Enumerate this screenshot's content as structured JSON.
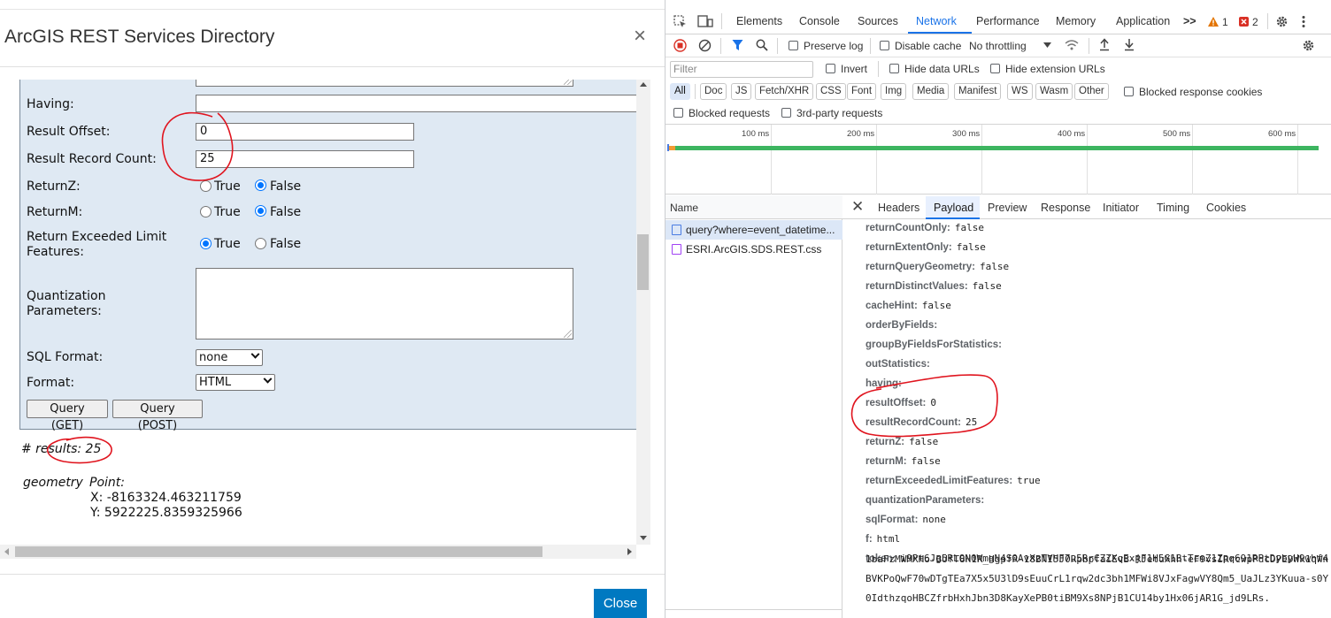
{
  "dialog": {
    "title": "ArcGIS REST Services Directory",
    "close_x": "×",
    "close_button": "Close",
    "form": {
      "having_label": "Having:",
      "result_offset_label": "Result Offset:",
      "result_offset_value": "0",
      "result_record_count_label": "Result Record Count:",
      "result_record_count_value": "25",
      "returnz_label": "ReturnZ:",
      "returnm_label": "ReturnM:",
      "exceeded_label_1": "Return Exceeded Limit",
      "exceeded_label_2": "Features:",
      "quant_label_1": "Quantization",
      "quant_label_2": "Parameters:",
      "sql_format_label": "SQL Format:",
      "sql_format_value": "none",
      "format_label": "Format:",
      "format_value": "HTML",
      "true_label": "True",
      "false_label": "False",
      "query_get": "Query (GET)",
      "query_post": "Query (POST)"
    },
    "results": {
      "count_text": "# results: 25",
      "geometry_label": "geometry",
      "geometry_type": "Point:",
      "x_text": "X: -8163324.463211759",
      "y_text": "Y: 5922225.8359325966"
    }
  },
  "devtools": {
    "tabs": [
      "Elements",
      "Console",
      "Sources",
      "Network",
      "Performance",
      "Memory",
      "Application"
    ],
    "active_tab": "Network",
    "more_tabs": ">>",
    "warnings_count": "1",
    "errors_count": "2",
    "toolbar": {
      "preserve_log": "Preserve log",
      "disable_cache": "Disable cache",
      "throttling": "No throttling"
    },
    "filter": {
      "placeholder": "Filter",
      "invert": "Invert",
      "hide_data_urls": "Hide data URLs",
      "hide_extension_urls": "Hide extension URLs"
    },
    "types": [
      "All",
      "Doc",
      "JS",
      "Fetch/XHR",
      "CSS",
      "Font",
      "Img",
      "Media",
      "Manifest",
      "WS",
      "Wasm",
      "Other"
    ],
    "blocked_response_cookies": "Blocked response cookies",
    "blocked_requests": "Blocked requests",
    "third_party_requests": "3rd-party requests",
    "timeline_ticks": [
      "100 ms",
      "200 ms",
      "300 ms",
      "400 ms",
      "500 ms",
      "600 ms"
    ],
    "request_list": {
      "header": "Name",
      "rows": [
        "query?where=event_datetime...",
        "ESRI.ArcGIS.SDS.REST.css"
      ]
    },
    "detail_tabs": [
      "Headers",
      "Payload",
      "Preview",
      "Response",
      "Initiator",
      "Timing",
      "Cookies"
    ],
    "active_detail_tab": "Payload",
    "payload": [
      {
        "k": "returnCountOnly:",
        "v": "false"
      },
      {
        "k": "returnExtentOnly:",
        "v": "false"
      },
      {
        "k": "returnQueryGeometry:",
        "v": "false"
      },
      {
        "k": "returnDistinctValues:",
        "v": "false"
      },
      {
        "k": "cacheHint:",
        "v": "false"
      },
      {
        "k": "orderByFields:",
        "v": ""
      },
      {
        "k": "groupByFieldsForStatistics:",
        "v": ""
      },
      {
        "k": "outStatistics:",
        "v": ""
      },
      {
        "k": "having:",
        "v": ""
      },
      {
        "k": "resultOffset:",
        "v": "0"
      },
      {
        "k": "resultRecordCount:",
        "v": "25"
      },
      {
        "k": "returnZ:",
        "v": "false"
      },
      {
        "k": "returnM:",
        "v": "false"
      },
      {
        "k": "returnExceededLimitFeatures:",
        "v": "true"
      },
      {
        "k": "quantizationParameters:",
        "v": ""
      },
      {
        "k": "sqlFormat:",
        "v": "none"
      },
      {
        "k": "f:",
        "v": "html"
      },
      {
        "k": "token:",
        "v": "i9Pt6Jg5RLON0WmgN4S0AvXzTVHF7u5RrCZZXqExjF1H5G1BtTcmZ1Zpq691RPtDybyH9whf4"
      }
    ],
    "token_continuation": [
      "1baFzMWMXHo-BUfT8H1R_HgpfR-18BNI5J0RpbpfaiEvB-RJetuXhh-eF9vsIRrcwpPdcDPEDWk1qWn",
      "BVKPoQwF70wDTgTEa7X5x5U3lD9sEuuCrL1rqw2dc3bh1MFWi8VJxFagwVY8Qm5_UaJLz3YKuua-s0Y",
      "0IdthzqoHBCZfrbHxhJbn3D8KayXePB0tiBM9Xs8NPjB1CU14by1Hx06jAR1G_jd9LRs."
    ]
  }
}
